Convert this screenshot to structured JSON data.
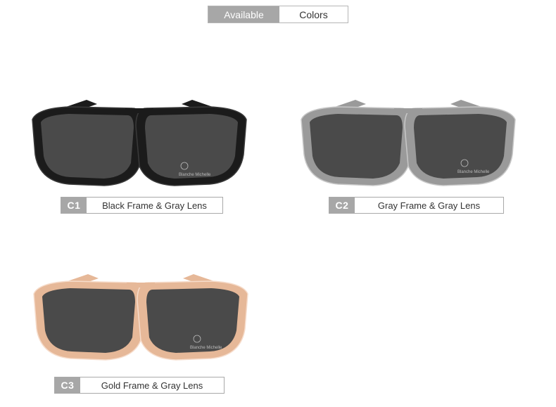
{
  "header": {
    "left_label": "Available",
    "right_label": "Colors"
  },
  "variants": [
    {
      "code": "C1",
      "name": "Black Frame & Gray Lens",
      "frame_color": "#1b1b1b",
      "frame_highlight": "#3a3a3a"
    },
    {
      "code": "C2",
      "name": "Gray Frame & Gray Lens",
      "frame_color": "#9a9a9a",
      "frame_highlight": "#c8c8c8"
    },
    {
      "code": "C3",
      "name": "Gold Frame & Gray Lens",
      "frame_color": "#e6b898",
      "frame_highlight": "#f6dccb"
    }
  ],
  "lens_color": "#4a4a4a",
  "logo_text": "Blanche Michelle"
}
